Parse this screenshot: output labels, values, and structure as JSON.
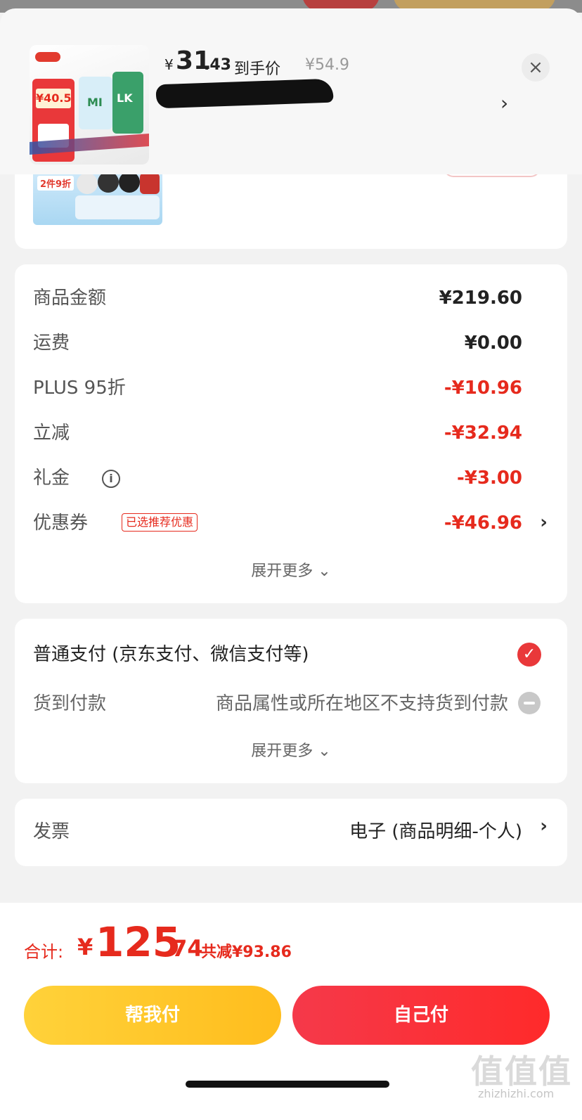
{
  "product_header": {
    "yen": "¥",
    "price_int": "31",
    "price_dec": ".43",
    "price_label": "到手价",
    "original_price": "¥54.9",
    "close_glyph": "×",
    "chevron": "›",
    "thumb_price": "¥40.5",
    "thumb_text_1": "MI",
    "thumb_text_2": "LK"
  },
  "promo_card": {
    "badge": "2件9折"
  },
  "summary": {
    "rows": [
      {
        "label": "商品金额",
        "value": "¥219.60"
      },
      {
        "label": "运费",
        "value": "¥0.00"
      },
      {
        "label": "PLUS 95折",
        "value": "-¥10.96"
      },
      {
        "label": "立减",
        "value": "-¥32.94"
      },
      {
        "label": "礼金",
        "value": "-¥3.00"
      },
      {
        "label": "优惠券",
        "value": "-¥46.96"
      }
    ],
    "coupon_badge": "已选推荐优惠",
    "info_glyph": "i",
    "chevron": "›",
    "expand": "展开更多 ⌄"
  },
  "payment": {
    "main_option": "普通支付 (京东支付、微信支付等)",
    "cod_label": "货到付款",
    "cod_note": "商品属性或所在地区不支持货到付款",
    "check_glyph": "✓",
    "expand": "展开更多 ⌄"
  },
  "invoice": {
    "label": "发票",
    "value": "电子 (商品明细-个人)",
    "chevron": "›"
  },
  "footer": {
    "total_label": "合计:",
    "yen": "¥",
    "total_int": "125",
    "total_dec": ".74",
    "saved": "共减¥93.86",
    "help_pay": "帮我付",
    "self_pay": "自己付"
  },
  "watermark": {
    "main": "值值值",
    "sub": "zhizhizhi.com"
  },
  "colors": {
    "accent_red": "#e62a1d",
    "button_yellow": "#ffc928",
    "button_red": "#f5394a"
  },
  "icons": [
    "close-icon",
    "chevron-right-icon",
    "info-icon",
    "check-circle-icon",
    "minus-circle-icon",
    "chevron-down-icon"
  ]
}
